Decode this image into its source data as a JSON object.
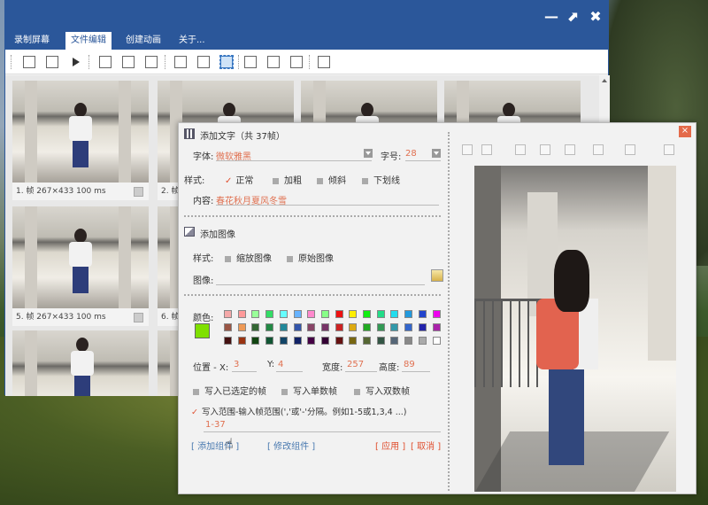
{
  "main_window": {
    "controls": {
      "minimize": "—",
      "maximize": "⬈",
      "close": "✖"
    },
    "menu": [
      "录制屏幕",
      "文件编辑",
      "创建动画",
      "关于..."
    ],
    "active_menu": "文件编辑",
    "frames": [
      {
        "caption": "1. 帧 267×433 100 ms"
      },
      {
        "caption": "2. 帧"
      },
      {
        "caption": ""
      },
      {
        "caption": ""
      },
      {
        "caption": "5. 帧 267×433 100 ms"
      },
      {
        "caption": "6. 帧"
      }
    ]
  },
  "dialog": {
    "close": "×",
    "text_section": {
      "title": "添加文字（共 37帧）",
      "font_label": "字体:",
      "font_value": "微软雅黑",
      "size_label": "字号:",
      "size_value": "28",
      "style_label": "样式:",
      "style_normal": "正常",
      "style_bold": "加粗",
      "style_italic": "倾斜",
      "style_underline": "下划线",
      "content_label": "内容:",
      "content_value": "春花秋月夏风冬雪"
    },
    "image_section": {
      "title": "添加图像",
      "style_label": "样式:",
      "style_scaled": "缩放图像",
      "style_original": "原始图像",
      "image_label": "图像:"
    },
    "color_section": {
      "label": "颜色:",
      "selected_color": "#7fe000",
      "palette": [
        "#f4a8a8",
        "#ff9a9a",
        "#99ff99",
        "#33dd66",
        "#66ffff",
        "#66b2ff",
        "#ff88cc",
        "#88ff88",
        "#ee1111",
        "#ffee00",
        "#11ee11",
        "#22dd88",
        "#22ddee",
        "#2299dd",
        "#2244cc",
        "#ee00ee",
        "#995544",
        "#ee9955",
        "#336633",
        "#228844",
        "#228899",
        "#3355aa",
        "#884466",
        "#773366",
        "#cc2222",
        "#ddaa11",
        "#22aa22",
        "#339955",
        "#3399aa",
        "#3366cc",
        "#2222aa",
        "#aa22aa",
        "#441111",
        "#993311",
        "#114411",
        "#115533",
        "#114466",
        "#112266",
        "#440044",
        "#330033",
        "#661111",
        "#776611",
        "#556633",
        "#335544",
        "#556677",
        "#888888",
        "#aaaaaa",
        "#ffffff"
      ]
    },
    "position": {
      "x_label": "位置 - X:",
      "x_value": "3",
      "y_label": "Y:",
      "y_value": "4",
      "width_label": "宽度:",
      "width_value": "257",
      "height_label": "高度:",
      "height_value": "89"
    },
    "write_options": {
      "selected_frames": "写入已选定的帧",
      "odd_frames": "写入单数帧",
      "even_frames": "写入双数帧",
      "range_label": "写入范围-输入帧范围(','或'-'分隔。例如1-5或1,3,4 ...)",
      "range_value": "1-37"
    },
    "buttons": {
      "add": "[ 添加组件 ]",
      "modify": "[ 修改组件 ]",
      "apply": "[ 应用 ]",
      "cancel": "[ 取消 ]"
    }
  }
}
